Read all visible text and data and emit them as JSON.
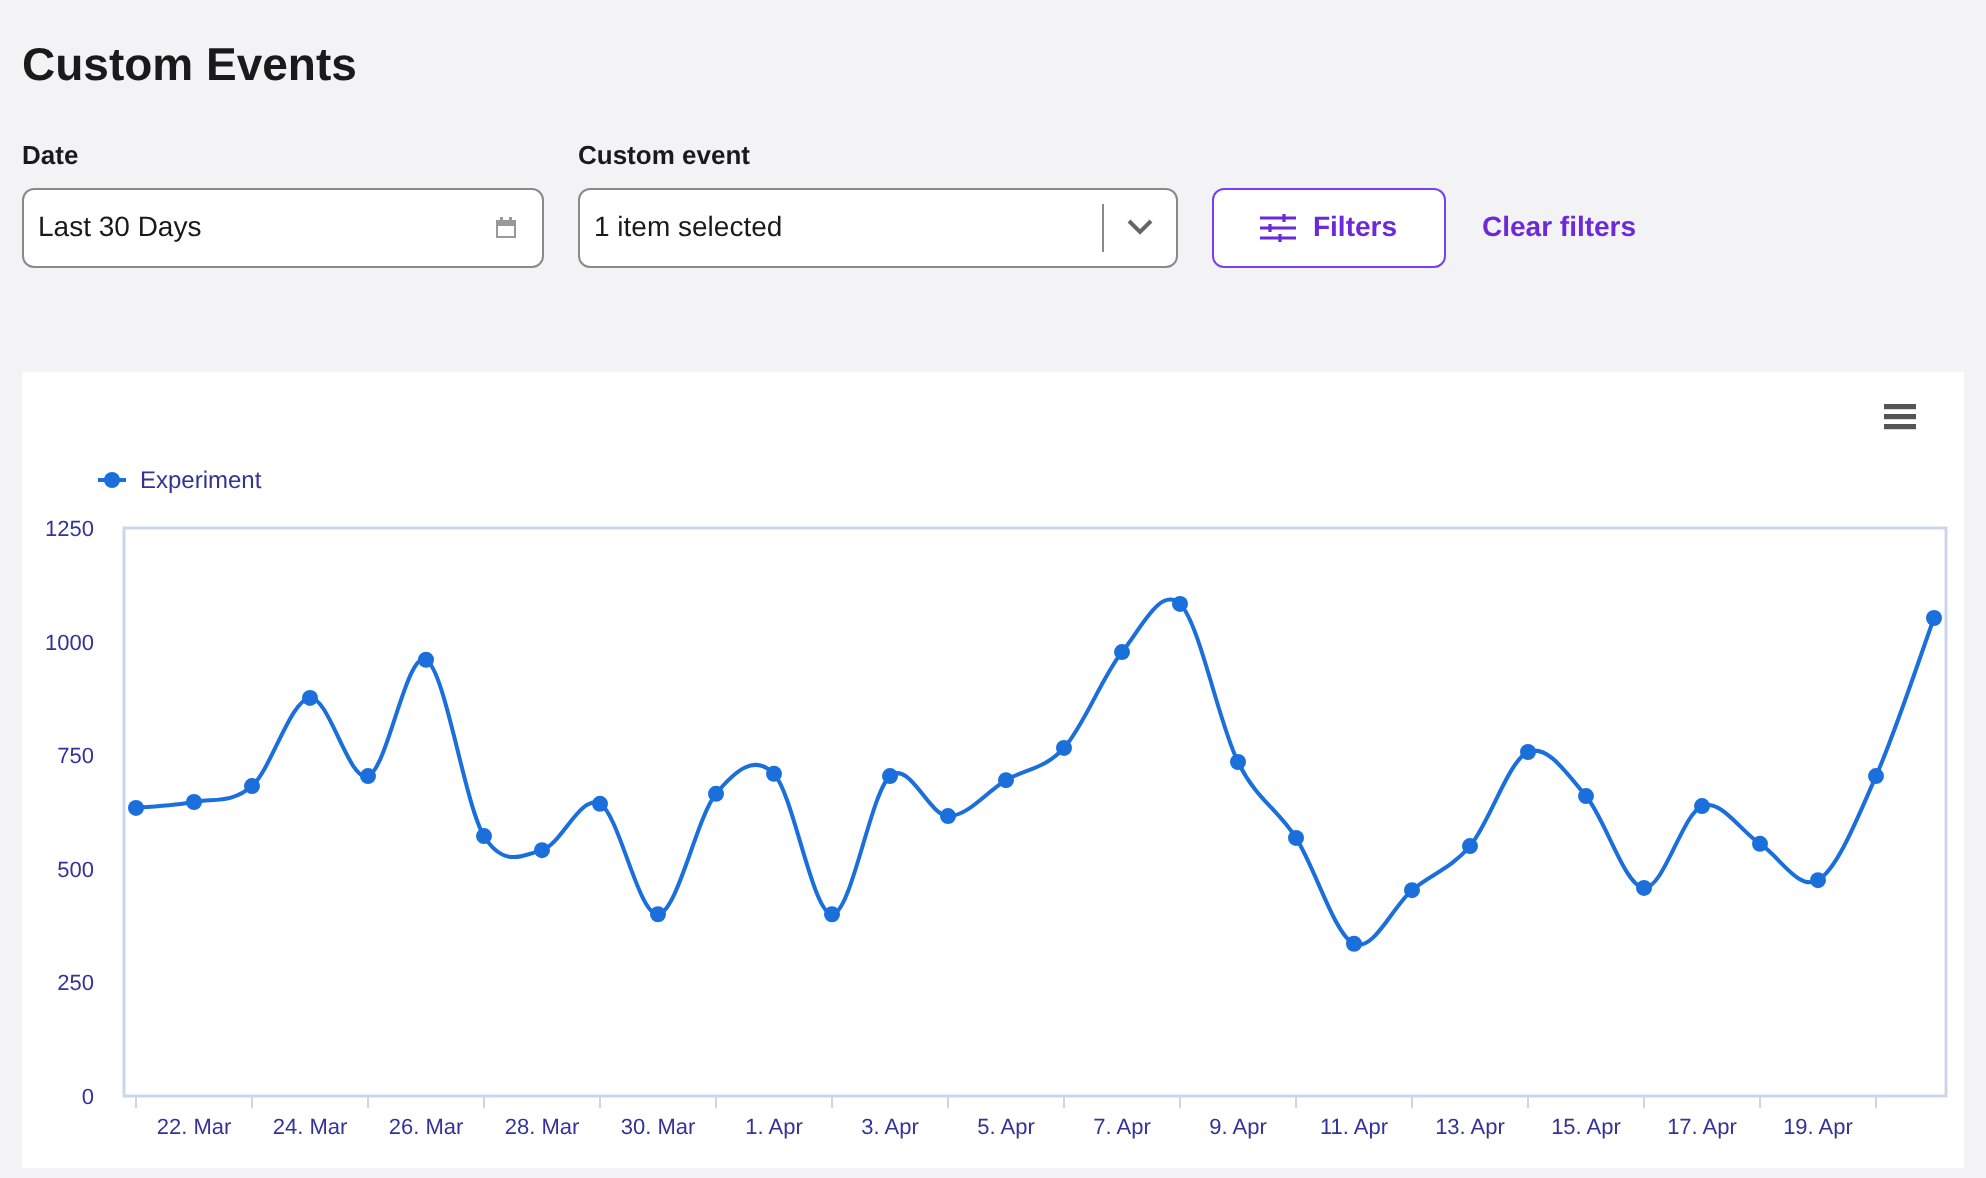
{
  "title": "Custom Events",
  "filters": [
    {
      "label": "Date",
      "value": "Last 30 Days",
      "kind": "date"
    },
    {
      "label": "Custom event",
      "value": "1 item selected",
      "kind": "select"
    }
  ],
  "filters_button": "Filters",
  "clear_filters": "Clear filters",
  "chart": {
    "chart_data": {
      "type": "line",
      "categories": [
        null,
        "22. Mar",
        null,
        "24. Mar",
        null,
        "26. Mar",
        null,
        "28. Mar",
        null,
        "30. Mar",
        null,
        "1. Apr",
        null,
        "3. Apr",
        null,
        "5. Apr",
        null,
        "7. Apr",
        null,
        "9. Apr",
        null,
        "11. Apr",
        null,
        "13. Apr",
        null,
        "15. Apr",
        null,
        "17. Apr",
        null,
        "19. Apr",
        null,
        null
      ],
      "series": [
        {
          "name": "Experiment",
          "color": "#1a6fdb",
          "marker": true,
          "values": [
            634,
            647,
            682,
            876,
            704,
            960,
            572,
            541,
            643,
            400,
            665,
            709,
            400,
            704,
            616,
            695,
            766,
            977,
            1083,
            735,
            568,
            335,
            453,
            550,
            757,
            660,
            458,
            638,
            555,
            475,
            704,
            1052
          ]
        }
      ],
      "ylim": [
        0,
        1250
      ],
      "yticks": [
        0,
        250,
        500,
        750,
        1000,
        1250
      ]
    }
  }
}
